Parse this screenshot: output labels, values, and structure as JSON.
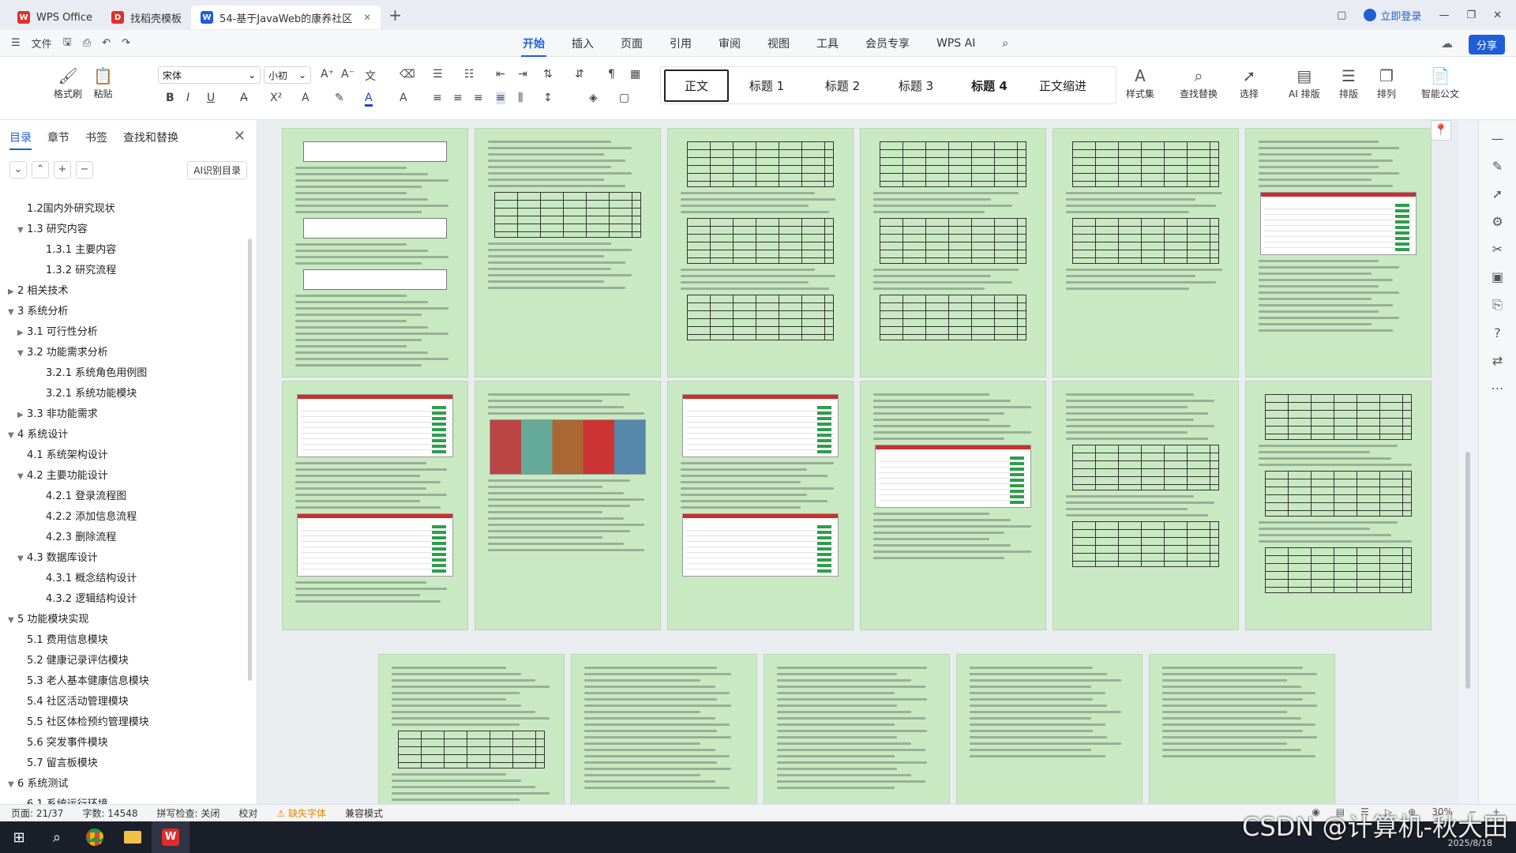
{
  "titlebar": {
    "tabs": [
      {
        "label": "WPS Office",
        "logo": "W",
        "color": "#e0302c"
      },
      {
        "label": "找稻壳模板",
        "logo": "D",
        "color": "#e0302c"
      },
      {
        "label": "54-基于JavaWeb的康养社区",
        "logo": "W",
        "color": "#1f5fd6"
      }
    ],
    "login_label": "立即登录"
  },
  "menu": {
    "file_label": "文件",
    "tabs": [
      "开始",
      "插入",
      "页面",
      "引用",
      "审阅",
      "视图",
      "工具",
      "会员专享",
      "WPS AI"
    ],
    "share_label": "分享"
  },
  "ribbon": {
    "format_painter": "格式刷",
    "paste": "粘贴",
    "font_name": "宋体",
    "font_size": "小初",
    "styles": [
      "正文",
      "标题 1",
      "标题 2",
      "标题 3",
      "标题 4",
      "正文缩进"
    ],
    "style_set": "样式集",
    "find_replace": "查找替换",
    "select": "选择",
    "ai_layout": "AI 排版",
    "layout": "排版",
    "arrange": "排列",
    "smart_doc": "智能公文"
  },
  "sidebar": {
    "tabs": [
      "目录",
      "章节",
      "书签",
      "查找和替换"
    ],
    "ai_toc": "AI识别目录",
    "toc": [
      {
        "label": "1.2国内外研究现状",
        "level": 2,
        "arrow": ""
      },
      {
        "label": "1.3 研究内容",
        "level": 2,
        "arrow": "▼"
      },
      {
        "label": "1.3.1 主要内容",
        "level": 3,
        "arrow": ""
      },
      {
        "label": "1.3.2 研究流程",
        "level": 3,
        "arrow": ""
      },
      {
        "label": "2 相关技术",
        "level": 1,
        "arrow": "▶"
      },
      {
        "label": "3 系统分析",
        "level": 1,
        "arrow": "▼"
      },
      {
        "label": "3.1 可行性分析",
        "level": 2,
        "arrow": "▶"
      },
      {
        "label": "3.2 功能需求分析",
        "level": 2,
        "arrow": "▼"
      },
      {
        "label": "3.2.1 系统角色用例图",
        "level": 3,
        "arrow": ""
      },
      {
        "label": "3.2.1 系统功能模块",
        "level": 3,
        "arrow": ""
      },
      {
        "label": "3.3 非功能需求",
        "level": 2,
        "arrow": "▶"
      },
      {
        "label": "4 系统设计",
        "level": 1,
        "arrow": "▼"
      },
      {
        "label": "4.1 系统架构设计",
        "level": 2,
        "arrow": ""
      },
      {
        "label": "4.2 主要功能设计",
        "level": 2,
        "arrow": "▼"
      },
      {
        "label": "4.2.1 登录流程图",
        "level": 3,
        "arrow": ""
      },
      {
        "label": "4.2.2 添加信息流程",
        "level": 3,
        "arrow": ""
      },
      {
        "label": "4.2.3 删除流程",
        "level": 3,
        "arrow": ""
      },
      {
        "label": "4.3 数据库设计",
        "level": 2,
        "arrow": "▼"
      },
      {
        "label": "4.3.1 概念结构设计",
        "level": 3,
        "arrow": ""
      },
      {
        "label": "4.3.2 逻辑结构设计",
        "level": 3,
        "arrow": ""
      },
      {
        "label": "5 功能模块实现",
        "level": 1,
        "arrow": "▼"
      },
      {
        "label": "5.1 费用信息模块",
        "level": 2,
        "arrow": ""
      },
      {
        "label": "5.2 健康记录评估模块",
        "level": 2,
        "arrow": ""
      },
      {
        "label": "5.3 老人基本健康信息模块",
        "level": 2,
        "arrow": ""
      },
      {
        "label": "5.4 社区活动管理模块",
        "level": 2,
        "arrow": ""
      },
      {
        "label": "5.5 社区体检预约管理模块",
        "level": 2,
        "arrow": ""
      },
      {
        "label": "5.6 突发事件模块",
        "level": 2,
        "arrow": ""
      },
      {
        "label": "5.7 留言板模块",
        "level": 2,
        "arrow": ""
      },
      {
        "label": "6 系统测试",
        "level": 1,
        "arrow": "▼"
      },
      {
        "label": "6.1 系统运行环境",
        "level": 2,
        "arrow": ""
      }
    ]
  },
  "status": {
    "page": "页面: 21/37",
    "words": "字数: 14548",
    "spell": "拼写检查: 关闭",
    "proof": "校对",
    "missing_font": "缺失字体",
    "compat": "兼容模式",
    "zoom": "30%"
  },
  "watermark": "CSDN @计算机-秋大田",
  "taskbar_date": "2025/8/18"
}
